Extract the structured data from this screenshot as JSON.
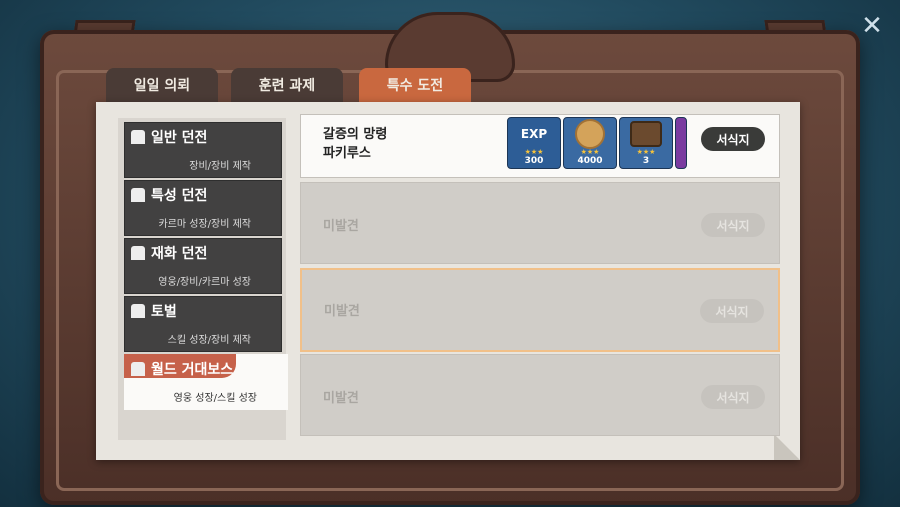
{
  "tabs": [
    {
      "label": "일일 의뢰"
    },
    {
      "label": "훈련 과제"
    },
    {
      "label": "특수 도전"
    }
  ],
  "categories": [
    {
      "title": "일반 던전",
      "subtitle": "장비/장비 제작"
    },
    {
      "title": "특성 던전",
      "subtitle": "카르마 성장/장비 제작"
    },
    {
      "title": "재화 던전",
      "subtitle": "영웅/장비/카르마 성장"
    },
    {
      "title": "토벌",
      "subtitle": "스킬 성장/장비 제작"
    },
    {
      "title": "월드 거대보스",
      "subtitle": "영웅 성장/스킬 성장"
    }
  ],
  "cards": [
    {
      "name": "갈증의 망령\n파키루스",
      "button": "서식지",
      "rewards": [
        {
          "label": "EXP",
          "stars": "★★★",
          "count": "300"
        },
        {
          "label": "",
          "stars": "★★★",
          "count": "4000"
        },
        {
          "label": "",
          "stars": "★★★",
          "count": "3"
        }
      ]
    },
    {
      "name": "미발견",
      "button": "서식지"
    },
    {
      "name": "미발견",
      "button": "서식지"
    },
    {
      "name": "미발견",
      "button": "서식지"
    }
  ]
}
